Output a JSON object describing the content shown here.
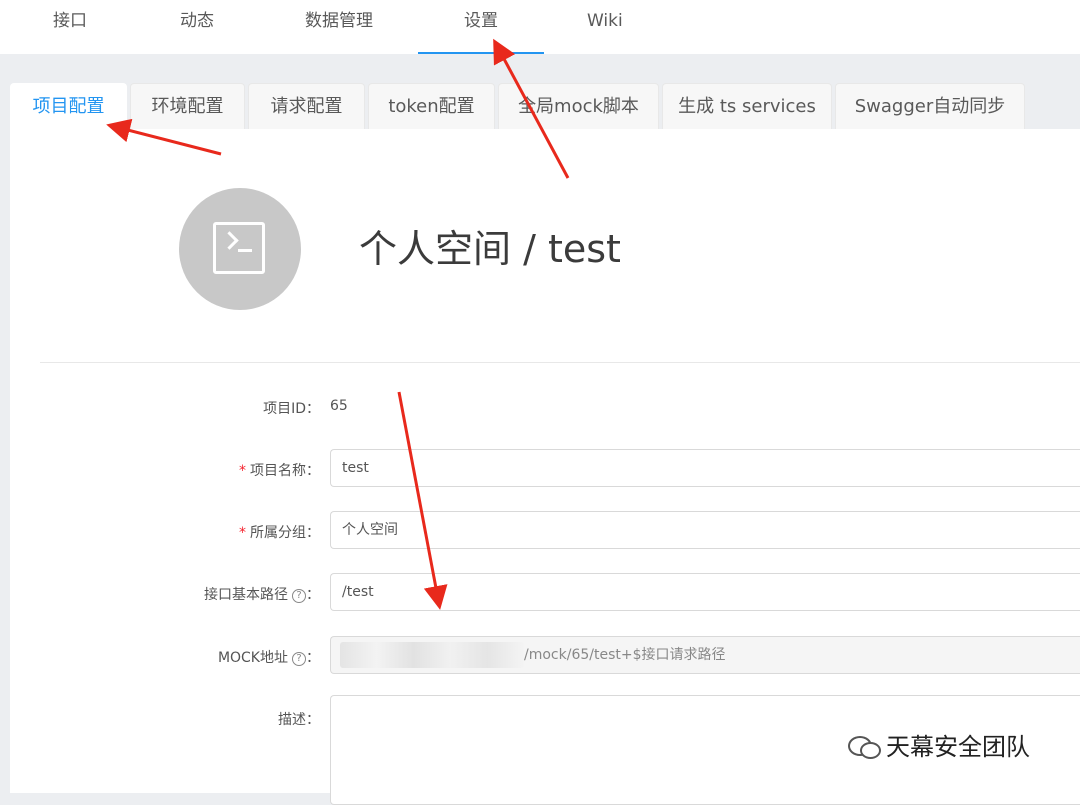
{
  "top_nav": {
    "items": [
      {
        "label": "接口"
      },
      {
        "label": "动态"
      },
      {
        "label": "数据管理"
      },
      {
        "label": "设置",
        "active": true
      },
      {
        "label": "Wiki"
      }
    ]
  },
  "tabs": [
    {
      "label": "项目配置",
      "active": true
    },
    {
      "label": "环境配置"
    },
    {
      "label": "请求配置"
    },
    {
      "label": "token配置"
    },
    {
      "label": "全局mock脚本"
    },
    {
      "label": "生成 ts services"
    },
    {
      "label": "Swagger自动同步"
    }
  ],
  "project": {
    "avatar_icon": "terminal-icon",
    "title": "个人空间 / test"
  },
  "form": {
    "project_id_label": "项目ID：",
    "project_id_value": "65",
    "name_label": "项目名称：",
    "name_value": "test",
    "group_label": "所属分组：",
    "group_value": "个人空间",
    "basepath_label": "接口基本路径",
    "basepath_value": "/test",
    "mock_label": "MOCK地址",
    "mock_value": "/mock/65/test+$接口请求路径",
    "desc_label": "描述：",
    "colon": "：",
    "help_glyph": "?",
    "required_mark": "*"
  },
  "watermark": {
    "text": "天幕安全团队",
    "icon": "wechat-icon"
  },
  "colors": {
    "accent": "#2395f1",
    "annotation": "#e8291c",
    "required": "#f5222d"
  }
}
